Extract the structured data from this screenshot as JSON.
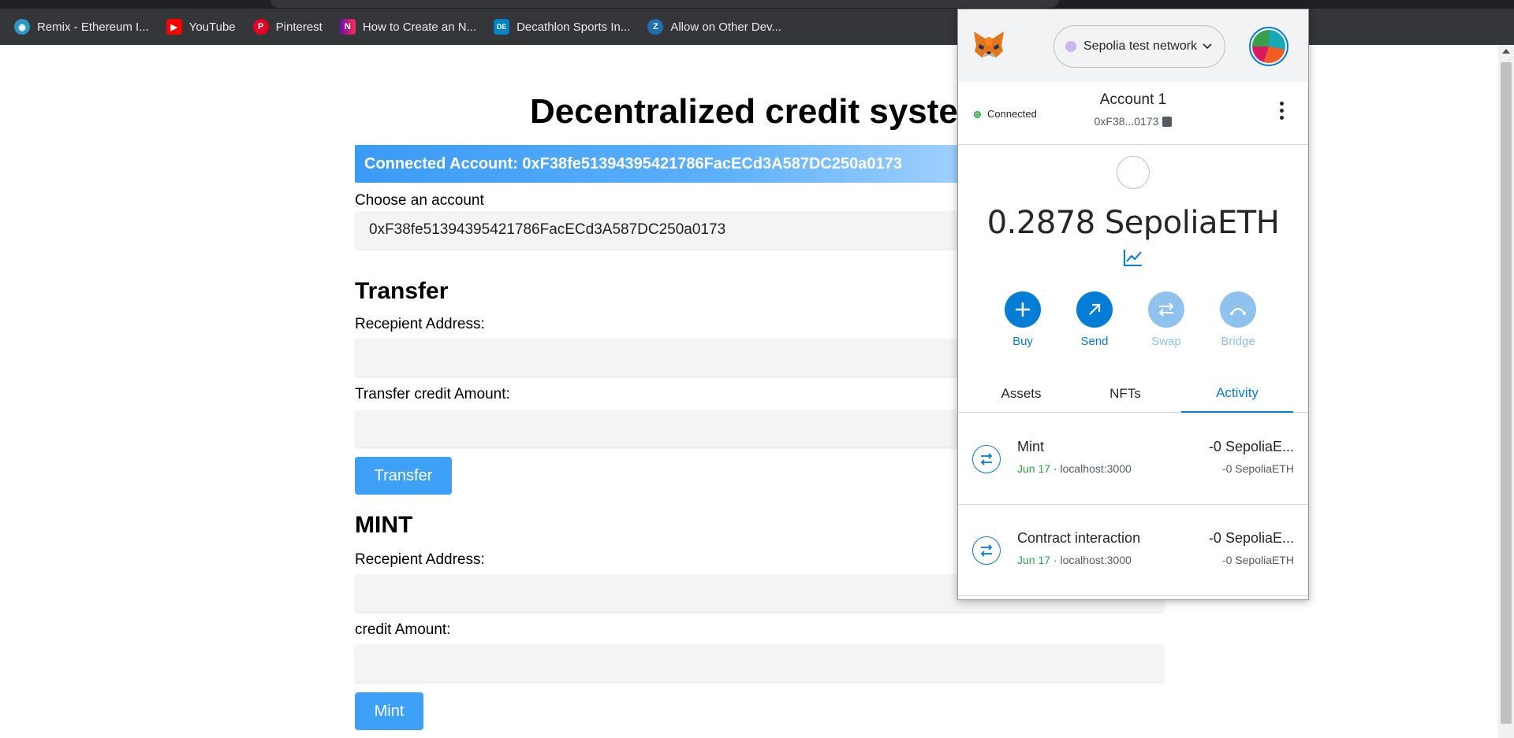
{
  "bookmarks": [
    {
      "label": "Remix - Ethereum I...",
      "icon": "remix-icon",
      "color": "#2c98c4"
    },
    {
      "label": "YouTube",
      "icon": "youtube-icon",
      "color": "#ff0000"
    },
    {
      "label": "Pinterest",
      "icon": "pinterest-icon",
      "color": "#e60023"
    },
    {
      "label": "How to Create an N...",
      "icon": "bookmark-n-icon",
      "color": "#6a0dad"
    },
    {
      "label": "Decathlon Sports In...",
      "icon": "decathlon-icon",
      "color": "#0082c3"
    },
    {
      "label": "Allow on Other Dev...",
      "icon": "zoho-icon",
      "color": "#226db4"
    }
  ],
  "app": {
    "title": "Decentralized credit system",
    "connected_account": "Connected Account: 0xF38fe51394395421786FacECd3A587DC250a0173",
    "choose_label": "Choose an account",
    "selected_account": "0xF38fe51394395421786FacECd3A587DC250a0173",
    "transfer": {
      "title": "Transfer",
      "recipient_label": "Recepient Address:",
      "amount_label": "Transfer credit Amount:",
      "button": "Transfer"
    },
    "mint": {
      "title": "MINT",
      "recipient_label": "Recepient Address:",
      "amount_label": "credit Amount:",
      "button": "Mint"
    }
  },
  "metamask": {
    "network": "Sepolia test network",
    "connected": "Connected",
    "account_name": "Account 1",
    "account_address": "0xF38...0173",
    "balance": "0.2878 SepoliaETH",
    "actions": [
      {
        "label": "Buy",
        "icon": "plus-icon",
        "enabled": true
      },
      {
        "label": "Send",
        "icon": "send-arrow-icon",
        "enabled": true
      },
      {
        "label": "Swap",
        "icon": "swap-icon",
        "enabled": false
      },
      {
        "label": "Bridge",
        "icon": "bridge-icon",
        "enabled": false
      }
    ],
    "tabs": [
      "Assets",
      "NFTs",
      "Activity"
    ],
    "active_tab": "Activity",
    "activity": [
      {
        "title": "Mint",
        "date": "Jun 17",
        "origin": " · localhost:3000",
        "amount": "-0 SepoliaE...",
        "amount_sub": "-0 SepoliaETH"
      },
      {
        "title": "Contract interaction",
        "date": "Jun 17",
        "origin": " · localhost:3000",
        "amount": "-0 SepoliaE...",
        "amount_sub": "-0 SepoliaETH"
      }
    ],
    "colors": {
      "primary": "#037dd6",
      "disabled": "#8fc3ee",
      "connected": "#28a745"
    }
  }
}
